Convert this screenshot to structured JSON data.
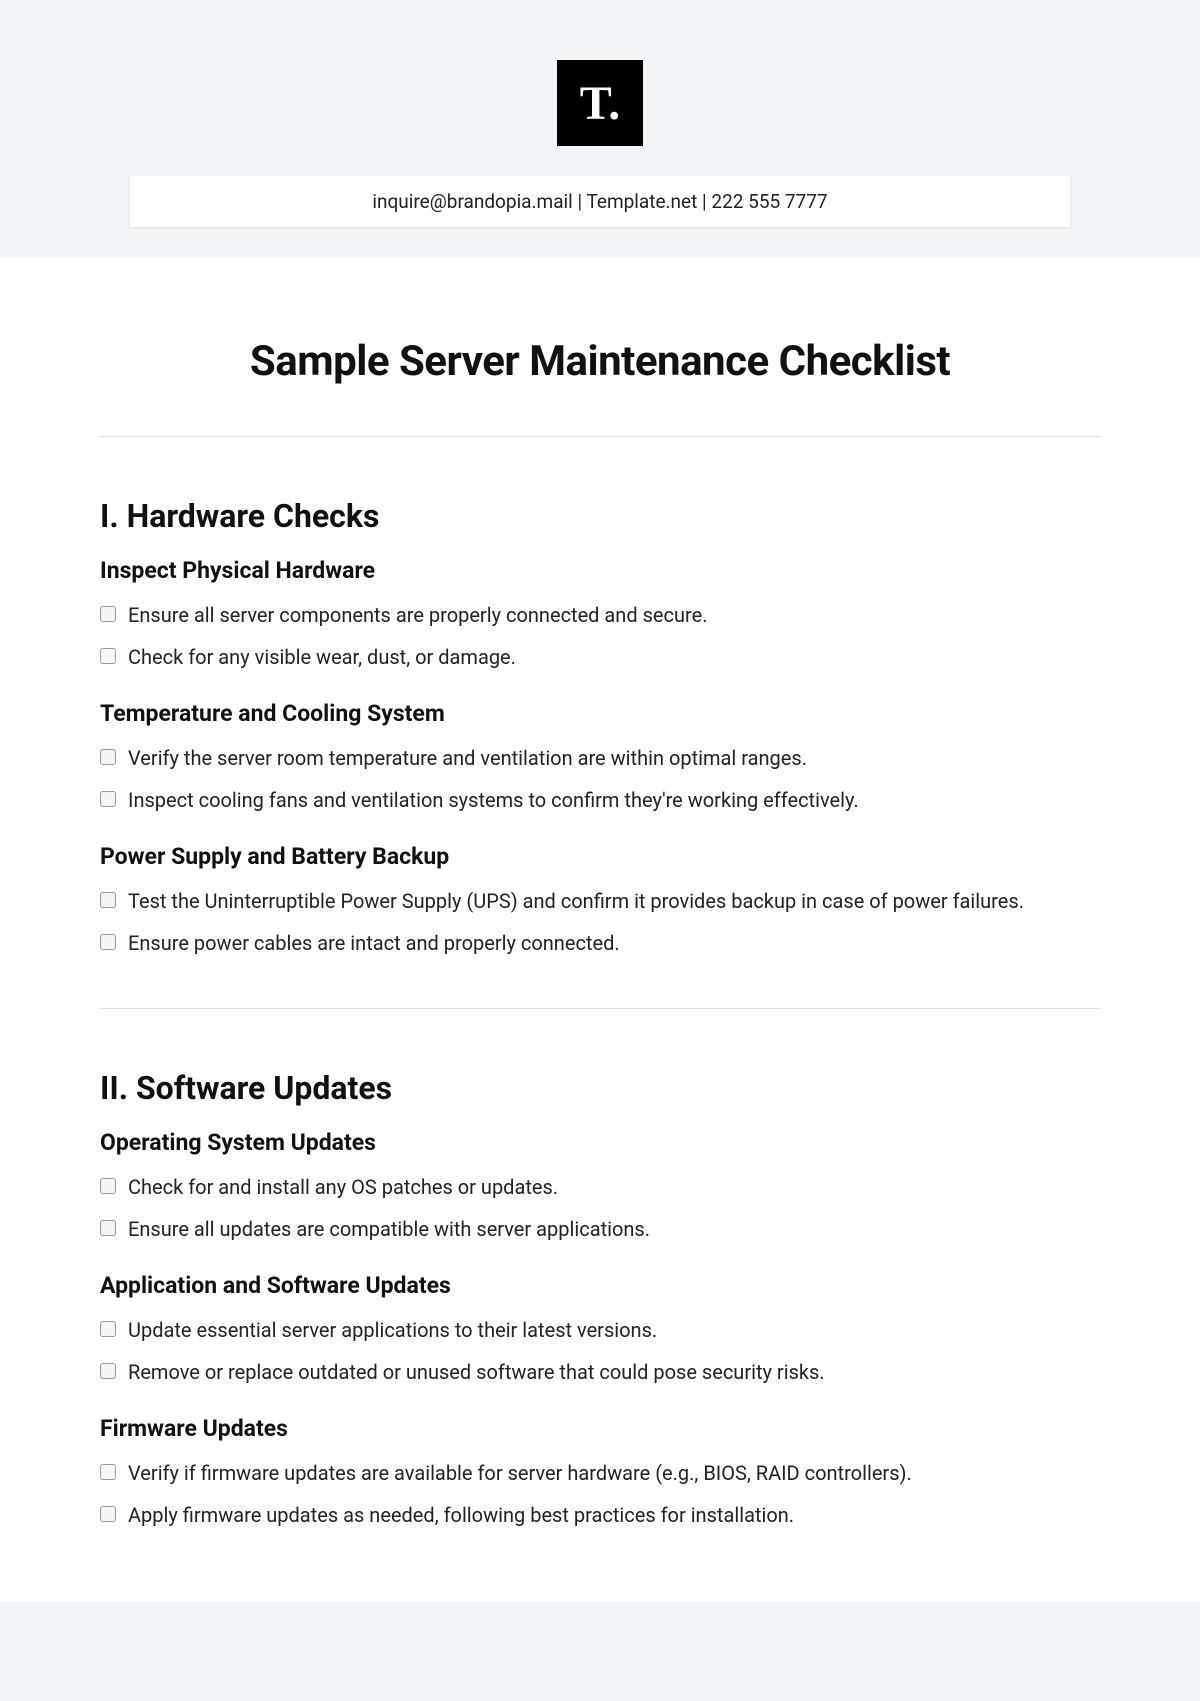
{
  "header": {
    "logo_text": "T.",
    "contact": "inquire@brandopia.mail  |  Template.net  |  222 555 7777"
  },
  "title": "Sample Server Maintenance Checklist",
  "sections": [
    {
      "heading": "I. Hardware Checks",
      "groups": [
        {
          "title": "Inspect Physical Hardware",
          "items": [
            "Ensure all server components are properly connected and secure.",
            "Check for any visible wear, dust, or damage."
          ]
        },
        {
          "title": "Temperature and Cooling System",
          "items": [
            "Verify the server room temperature and ventilation are within optimal ranges.",
            "Inspect cooling fans and ventilation systems to confirm they're working effectively."
          ]
        },
        {
          "title": "Power Supply and Battery Backup",
          "items": [
            "Test the Uninterruptible Power Supply (UPS) and confirm it provides backup in case of power failures.",
            "Ensure power cables are intact and properly connected."
          ]
        }
      ]
    },
    {
      "heading": "II. Software Updates",
      "groups": [
        {
          "title": "Operating System Updates",
          "items": [
            "Check for and install any OS patches or updates.",
            "Ensure all updates are compatible with server applications."
          ]
        },
        {
          "title": "Application and Software Updates",
          "items": [
            "Update essential server applications to their latest versions.",
            "Remove or replace outdated or unused software that could pose security risks."
          ]
        },
        {
          "title": "Firmware Updates",
          "items": [
            "Verify if firmware updates are available for server hardware (e.g., BIOS, RAID controllers).",
            "Apply firmware updates as needed, following best practices for installation."
          ]
        }
      ]
    }
  ]
}
